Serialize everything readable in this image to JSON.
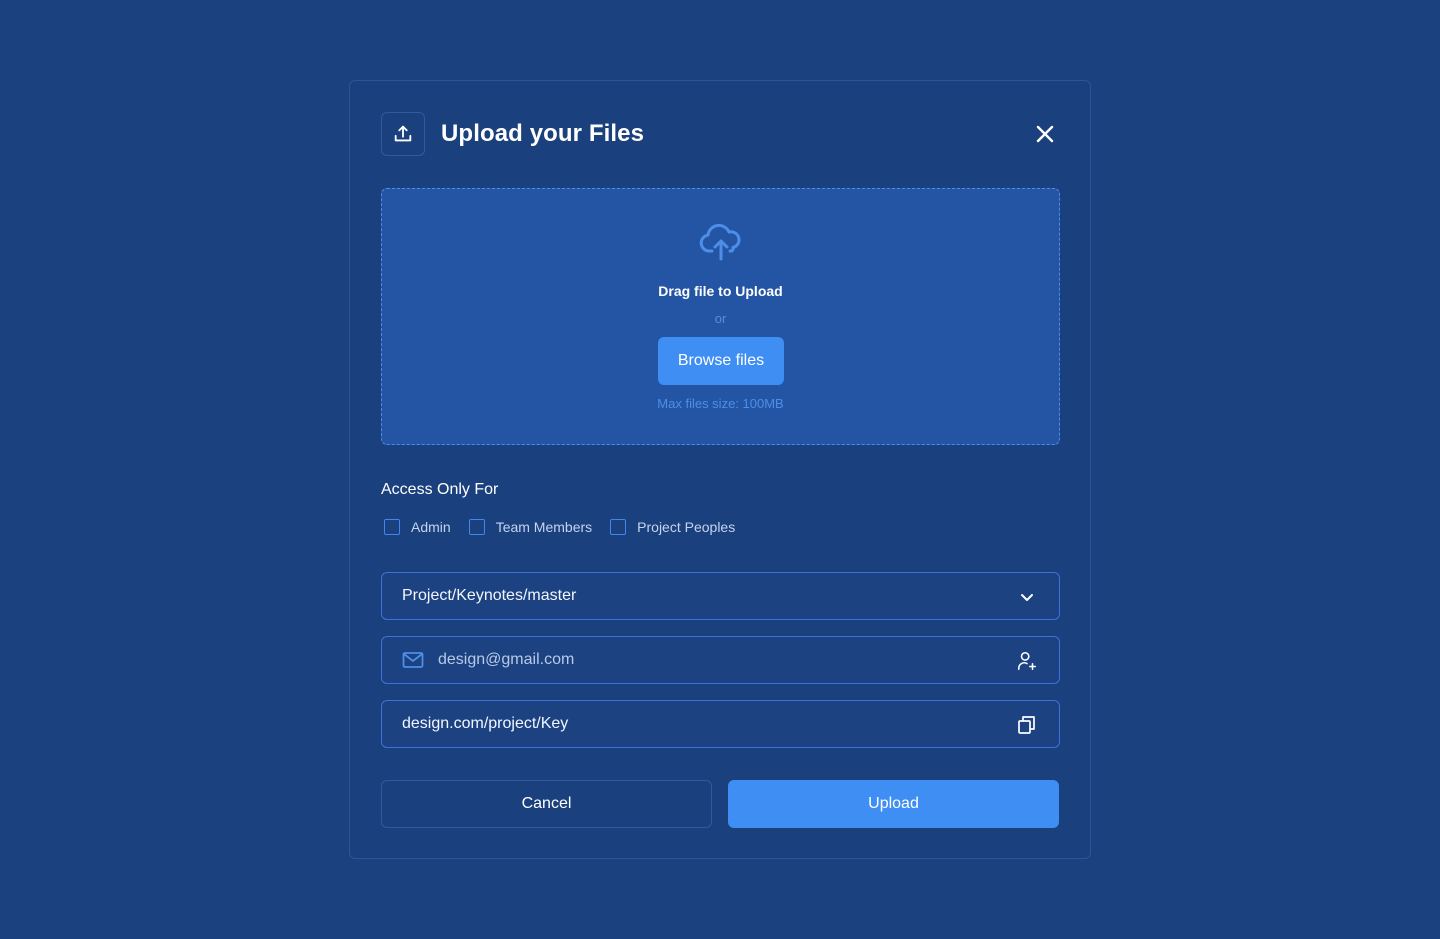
{
  "modal": {
    "title": "Upload your Files",
    "header_icon": "upload-icon",
    "close_icon": "close-icon"
  },
  "dropzone": {
    "icon": "cloud-upload-icon",
    "drag_text": "Drag file to Upload",
    "or_text": "or",
    "browse_label": "Browse files",
    "max_size_text": "Max files size: 100MB"
  },
  "access": {
    "label": "Access Only For",
    "options": [
      {
        "label": "Admin",
        "checked": false
      },
      {
        "label": "Team Members",
        "checked": false
      },
      {
        "label": "Project Peoples",
        "checked": false
      }
    ]
  },
  "fields": {
    "path_select": {
      "value": "Project/Keynotes/master",
      "icon": "chevron-down-icon"
    },
    "email": {
      "value": "design@gmail.com",
      "left_icon": "mail-icon",
      "right_icon": "add-user-icon"
    },
    "link": {
      "value": "design.com/project/Key",
      "icon": "copy-icon"
    }
  },
  "actions": {
    "cancel_label": "Cancel",
    "upload_label": "Upload"
  },
  "colors": {
    "background": "#1b417f",
    "dropzone": "#2455a4",
    "accent": "#3f8ef3",
    "border": "#3a74d6"
  }
}
